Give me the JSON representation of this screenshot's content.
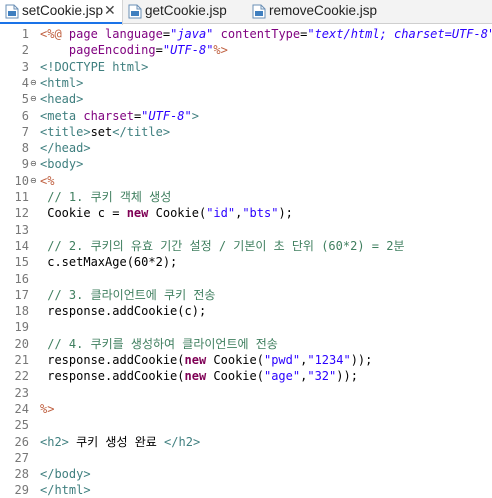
{
  "tabs": [
    {
      "label": "setCookie.jsp",
      "active": true,
      "close_glyph": "✕"
    },
    {
      "label": "getCookie.jsp"
    },
    {
      "label": "removeCookie.jsp"
    }
  ],
  "tab_icon": "jsp-file-icon",
  "colors": {
    "tag": "#3f7f7f",
    "attribute": "#7f007f",
    "attribute_value": "#2a00ff",
    "jsp_delimiter": "#bf5f3f",
    "keyword": "#7f0055",
    "string": "#2a00ff",
    "comment": "#3f7f5f",
    "line_number": "#777777"
  },
  "lines": [
    {
      "n": "1",
      "fold": "",
      "tokens": [
        [
          "jsp",
          "<%@ "
        ],
        [
          "attr",
          "page "
        ],
        [
          "attr",
          "language"
        ],
        [
          "",
          "="
        ],
        [
          "val",
          "\"java\""
        ],
        [
          "",
          ""
        ],
        [
          "attr",
          " contentType"
        ],
        [
          "",
          "="
        ],
        [
          "val",
          "\"text/html; charset=UTF-8\""
        ]
      ]
    },
    {
      "n": "2",
      "fold": "",
      "tokens": [
        [
          "",
          "    "
        ],
        [
          "attr",
          "pageEncoding"
        ],
        [
          "",
          "="
        ],
        [
          "val",
          "\"UTF-8\""
        ],
        [
          "jsp",
          "%>"
        ]
      ]
    },
    {
      "n": "3",
      "fold": "",
      "tokens": [
        [
          "dt",
          "<!DOCTYPE html>"
        ]
      ]
    },
    {
      "n": "4",
      "fold": "⊖",
      "tokens": [
        [
          "tag",
          "<html>"
        ]
      ]
    },
    {
      "n": "5",
      "fold": "⊖",
      "tokens": [
        [
          "tag",
          "<head>"
        ]
      ]
    },
    {
      "n": "6",
      "fold": "",
      "tokens": [
        [
          "tag",
          "<meta "
        ],
        [
          "attr",
          "charset"
        ],
        [
          "",
          "="
        ],
        [
          "val",
          "\"UTF-8\""
        ],
        [
          "tag",
          ">"
        ]
      ]
    },
    {
      "n": "7",
      "fold": "",
      "tokens": [
        [
          "tag",
          "<title>"
        ],
        [
          "",
          "set"
        ],
        [
          "tag",
          "</title>"
        ]
      ]
    },
    {
      "n": "8",
      "fold": "",
      "tokens": [
        [
          "tag",
          "</head>"
        ]
      ]
    },
    {
      "n": "9",
      "fold": "⊖",
      "tokens": [
        [
          "tag",
          "<body>"
        ]
      ]
    },
    {
      "n": "10",
      "fold": "⊖",
      "tokens": [
        [
          "jsp",
          "<%"
        ]
      ]
    },
    {
      "n": "11",
      "fold": "",
      "tokens": [
        [
          "cmt",
          " // 1. 쿠키 객체 생성"
        ]
      ]
    },
    {
      "n": "12",
      "fold": "",
      "tokens": [
        [
          "",
          " Cookie c = "
        ],
        [
          "kw",
          "new"
        ],
        [
          "",
          " Cookie("
        ],
        [
          "str",
          "\"id\""
        ],
        [
          "",
          ","
        ],
        [
          "str",
          "\"bts\""
        ],
        [
          "",
          ");"
        ]
      ]
    },
    {
      "n": "13",
      "fold": "",
      "tokens": [
        [
          "",
          ""
        ]
      ]
    },
    {
      "n": "14",
      "fold": "",
      "tokens": [
        [
          "cmt",
          " // 2. 쿠키의 유효 기간 설정 / 기본이 초 단위 (60*2) = 2분"
        ]
      ]
    },
    {
      "n": "15",
      "fold": "",
      "tokens": [
        [
          "",
          " c.setMaxAge(60*2);"
        ]
      ]
    },
    {
      "n": "16",
      "fold": "",
      "tokens": [
        [
          "",
          ""
        ]
      ]
    },
    {
      "n": "17",
      "fold": "",
      "tokens": [
        [
          "cmt",
          " // 3. 클라이언트에 쿠키 전송"
        ]
      ]
    },
    {
      "n": "18",
      "fold": "",
      "tokens": [
        [
          "",
          " response.addCookie(c);"
        ]
      ]
    },
    {
      "n": "19",
      "fold": "",
      "tokens": [
        [
          "",
          ""
        ]
      ]
    },
    {
      "n": "20",
      "fold": "",
      "tokens": [
        [
          "cmt",
          " // 4. 쿠키를 생성하여 클라이언트에 전송"
        ]
      ]
    },
    {
      "n": "21",
      "fold": "",
      "tokens": [
        [
          "",
          " response.addCookie("
        ],
        [
          "kw",
          "new"
        ],
        [
          "",
          " Cookie("
        ],
        [
          "str",
          "\"pwd\""
        ],
        [
          "",
          ","
        ],
        [
          "str",
          "\"1234\""
        ],
        [
          "",
          "));"
        ]
      ]
    },
    {
      "n": "22",
      "fold": "",
      "tokens": [
        [
          "",
          " response.addCookie("
        ],
        [
          "kw",
          "new"
        ],
        [
          "",
          " Cookie("
        ],
        [
          "str",
          "\"age\""
        ],
        [
          "",
          ","
        ],
        [
          "str",
          "\"32\""
        ],
        [
          "",
          "));"
        ]
      ]
    },
    {
      "n": "23",
      "fold": "",
      "tokens": [
        [
          "",
          ""
        ]
      ]
    },
    {
      "n": "24",
      "fold": "",
      "tokens": [
        [
          "jsp",
          "%>"
        ]
      ]
    },
    {
      "n": "25",
      "fold": "",
      "tokens": [
        [
          "",
          ""
        ]
      ]
    },
    {
      "n": "26",
      "fold": "",
      "tokens": [
        [
          "tag",
          "<h2>"
        ],
        [
          "",
          " 쿠키 생성 완료 "
        ],
        [
          "tag",
          "</h2>"
        ]
      ]
    },
    {
      "n": "27",
      "fold": "",
      "tokens": [
        [
          "",
          ""
        ]
      ]
    },
    {
      "n": "28",
      "fold": "",
      "tokens": [
        [
          "tag",
          "</body>"
        ]
      ]
    },
    {
      "n": "29",
      "fold": "",
      "tokens": [
        [
          "tag",
          "</html>"
        ]
      ]
    }
  ]
}
